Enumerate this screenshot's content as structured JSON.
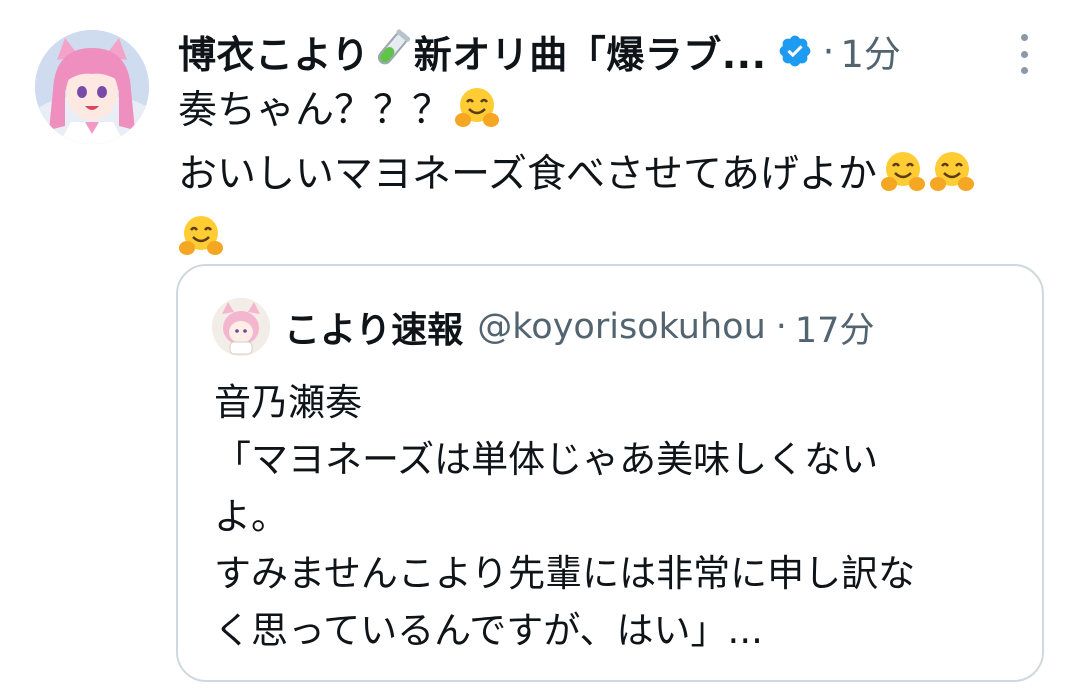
{
  "tweet": {
    "author_name": "博衣こより",
    "author_name_suffix": "新オリ曲「爆ラブ...",
    "verified_icon": "verified-badge-icon",
    "separator": "·",
    "time": "1分",
    "more_icon": "more-vertical-icon",
    "text_line_1": "奏ちゃん？？？",
    "text_line_2": "おいしいマヨネーズ食べさせてあげよか",
    "emoji_name": "hugging-face-emoji",
    "colors": {
      "verified": "#1d9bf0",
      "secondary_text": "#536471",
      "border": "#cfd9de"
    }
  },
  "quoted_tweet": {
    "author_name": "こより速報",
    "handle": "@koyorisokuhou",
    "separator": "·",
    "time": "17分",
    "lines": [
      "音乃瀬奏",
      "「マヨネーズは単体じゃあ美味しくない",
      "よ。",
      "すみませんこより先輩には非常に申し訳な",
      "く思っているんですが、はい」..."
    ]
  }
}
